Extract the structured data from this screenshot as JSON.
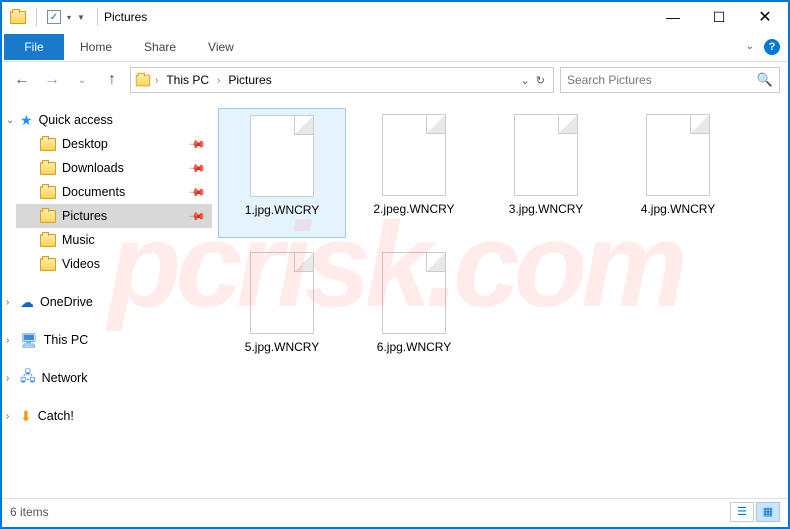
{
  "titlebar": {
    "title": "Pictures"
  },
  "ribbon": {
    "file": "File",
    "tabs": [
      "Home",
      "Share",
      "View"
    ]
  },
  "breadcrumbs": [
    "This PC",
    "Pictures"
  ],
  "search": {
    "placeholder": "Search Pictures"
  },
  "sidebar": {
    "quick_access": "Quick access",
    "items": [
      {
        "label": "Desktop",
        "pinned": true
      },
      {
        "label": "Downloads",
        "pinned": true
      },
      {
        "label": "Documents",
        "pinned": true
      },
      {
        "label": "Pictures",
        "pinned": true,
        "selected": true
      },
      {
        "label": "Music",
        "pinned": false
      },
      {
        "label": "Videos",
        "pinned": false
      }
    ],
    "onedrive": "OneDrive",
    "thispc": "This PC",
    "network": "Network",
    "catch": "Catch!"
  },
  "files": [
    {
      "name": "1.jpg.WNCRY",
      "selected": true
    },
    {
      "name": "2.jpeg.WNCRY"
    },
    {
      "name": "3.jpg.WNCRY"
    },
    {
      "name": "4.jpg.WNCRY"
    },
    {
      "name": "5.jpg.WNCRY"
    },
    {
      "name": "6.jpg.WNCRY"
    }
  ],
  "status": {
    "count": "6 items"
  },
  "watermark": "pcrisk.com"
}
